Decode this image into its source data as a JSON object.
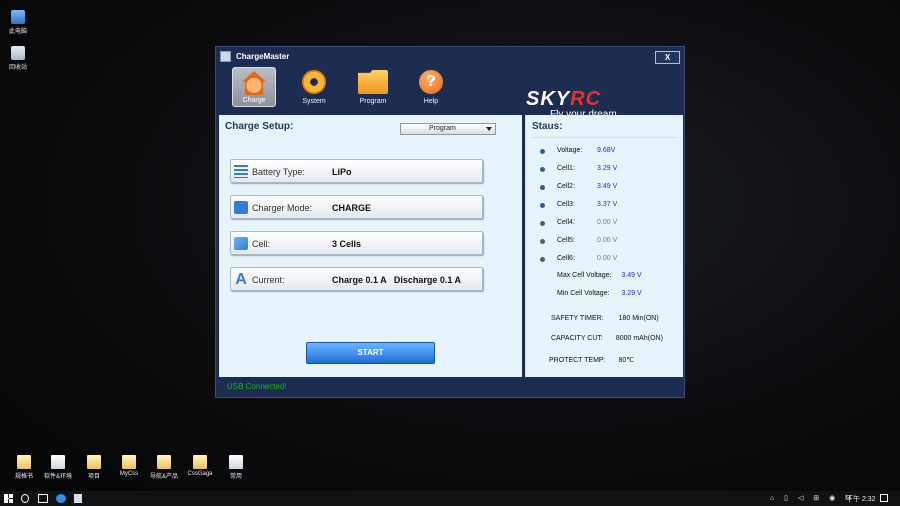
{
  "desktop": {
    "top_icons": [
      {
        "label": "此电脑",
        "icon": "computer-icon"
      },
      {
        "label": "回收站",
        "icon": "recycle-bin-icon"
      }
    ],
    "bottom_icons": [
      {
        "label": "规格书",
        "icon": "file-icon"
      },
      {
        "label": "软件&环境",
        "icon": "file-icon"
      },
      {
        "label": "项目",
        "icon": "file-icon"
      },
      {
        "label": "MyCss",
        "icon": "file-icon"
      },
      {
        "label": "导航&产品",
        "icon": "file-icon"
      },
      {
        "label": "CssGaga",
        "icon": "file-icon"
      },
      {
        "label": "常用",
        "icon": "file-icon"
      }
    ]
  },
  "window": {
    "title": "ChargeMaster",
    "close_label": "X",
    "toolbar": [
      {
        "label": "Charge",
        "icon": "home-charge-icon",
        "active": true
      },
      {
        "label": "System",
        "icon": "gear-icon",
        "active": false
      },
      {
        "label": "Program",
        "icon": "folder-icon",
        "active": false
      },
      {
        "label": "Help",
        "icon": "help-icon",
        "active": false
      }
    ],
    "brand": {
      "logo_main": "SKY",
      "logo_accent": "RC",
      "tagline": "Fly your dream",
      "accent_color": "#e8322a"
    },
    "charge_setup": {
      "title": "Charge Setup:",
      "program_select": "Program",
      "rows": [
        {
          "label": "Battery Type:",
          "value": "LiPo",
          "icon": "list-icon"
        },
        {
          "label": "Charger Mode:",
          "value": "CHARGE",
          "icon": "battery-icon"
        },
        {
          "label": "Cell:",
          "value": "3 Cells",
          "icon": "cells-icon"
        },
        {
          "label": "Current:",
          "value": "Charge 0.1 A   Discharge 0.1 A",
          "icon": "current-icon"
        }
      ],
      "start_label": "START"
    },
    "status": {
      "title": "Staus:",
      "lines": [
        {
          "label": "Voltage:",
          "value": "9.68V",
          "active": true
        },
        {
          "label": "Cell1:",
          "value": "3.29 V",
          "active": true
        },
        {
          "label": "Cell2:",
          "value": "3.49 V",
          "active": true
        },
        {
          "label": "Cell3:",
          "value": "3.37 V",
          "active": true
        },
        {
          "label": "Cell4:",
          "value": "0.00 V",
          "active": false
        },
        {
          "label": "Cell5:",
          "value": "0.00 V",
          "active": false
        },
        {
          "label": "Cell6:",
          "value": "0.00 V",
          "active": false
        }
      ],
      "max_cell_label": "Max Cell Voltage:",
      "max_cell_value": "3.49 V",
      "min_cell_label": "Min Cell Voltage:",
      "min_cell_value": "3.29 V",
      "safety_timer_label": "SAFETY TIMER:",
      "safety_timer_value": "180 Min(ON)",
      "capacity_cut_label": "CAPACITY CUT:",
      "capacity_cut_value": "8000 mAh(ON)",
      "protect_temp_label": "PROTECT TEMP:",
      "protect_temp_value": "80℃"
    },
    "statusbar": {
      "usb_text": "USB  Connected!",
      "usb_color": "#16b514"
    }
  },
  "taskbar": {
    "tray_icons": "⌂ ▯ ◁ ⊞ ◉ M",
    "time": "下午 2:32"
  }
}
